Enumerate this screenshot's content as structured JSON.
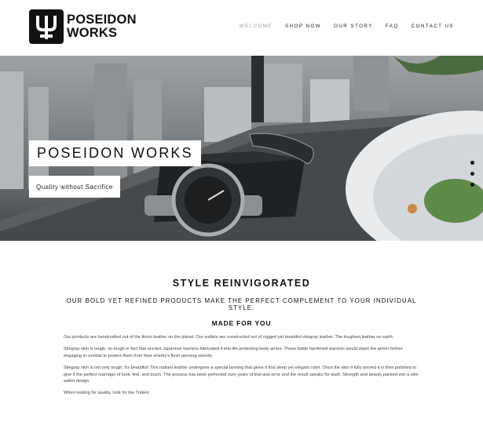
{
  "brand": {
    "line1": "POSEIDON",
    "line2": "WORKS",
    "logo_icon": "trident-icon"
  },
  "nav": {
    "items": [
      {
        "label": "WELCOME",
        "active": true
      },
      {
        "label": "SHOP NOW",
        "active": false
      },
      {
        "label": "OUR STORY",
        "active": false
      },
      {
        "label": "FAQ",
        "active": false
      },
      {
        "label": "CONTACT US",
        "active": false
      }
    ]
  },
  "hero": {
    "title": "POSEIDON WORKS",
    "tagline": "Quality without Sacrifice",
    "slides": 3,
    "current_slide": 1
  },
  "content": {
    "heading": "STYLE REINVIGORATED",
    "subheading": "OUR BOLD YET REFINED PRODUCTS MAKE THE PERFECT COMPLEMENT TO YOUR INDIVIDUAL STYLE.",
    "section_title": "MADE FOR YOU",
    "paragraphs": [
      "Our products are handcrafted out of the finest leather on the planet.  Our wallets are constructed out of rugged yet beautiful stingray leather. The toughest leather on earth.",
      "Stingray skin is tough, so tough in fact that ancient Japanese warriors fabricated it into life protecting body armor. These battle hardened warriors would dawn the armor before engaging in combat to protect them from their enemy's flesh piercing swords.",
      "Stingray skin is not only tough; it's beautiful!  This radiant leather undergoes a special tanning that gives it that deep yet elegant color. Once the skin if fully tanned it is then polished to give it the perfect marriage of look, feel, and touch. The process has been perfected over years of trial and error and the result speaks for itself. Strength and beauty packed into a slim wallet design.",
      "When looking for quality, look for the Trident."
    ]
  }
}
